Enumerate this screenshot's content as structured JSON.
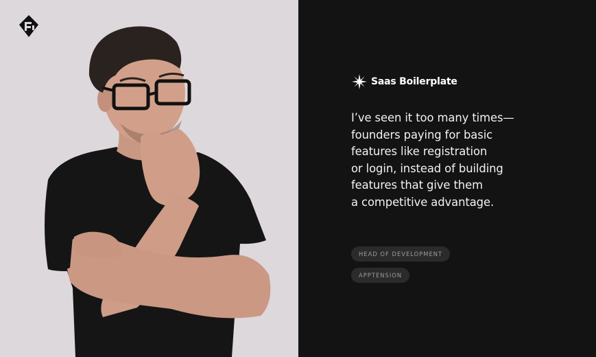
{
  "brand": {
    "name": "Saas Boilerplate",
    "icon": "starburst-icon"
  },
  "logo": {
    "icon": "apptension-logo-icon"
  },
  "photo": {
    "subject": ""
  },
  "testimonial": {
    "quote_lines": [
      "I’ve seen it too many times—",
      "founders paying for basic",
      "features like registration",
      "or login, instead of building",
      "features that give them",
      "a competitive advantage."
    ]
  },
  "author": {
    "role": "HEAD OF DEVELOPMENT",
    "company": "APPTENSION"
  },
  "colors": {
    "left_background": "#ddd8dc",
    "right_background": "#131313",
    "tag_background": "#2b2b2b",
    "tag_text": "#9d9d9d",
    "quote_text": "#f2f2f2"
  }
}
